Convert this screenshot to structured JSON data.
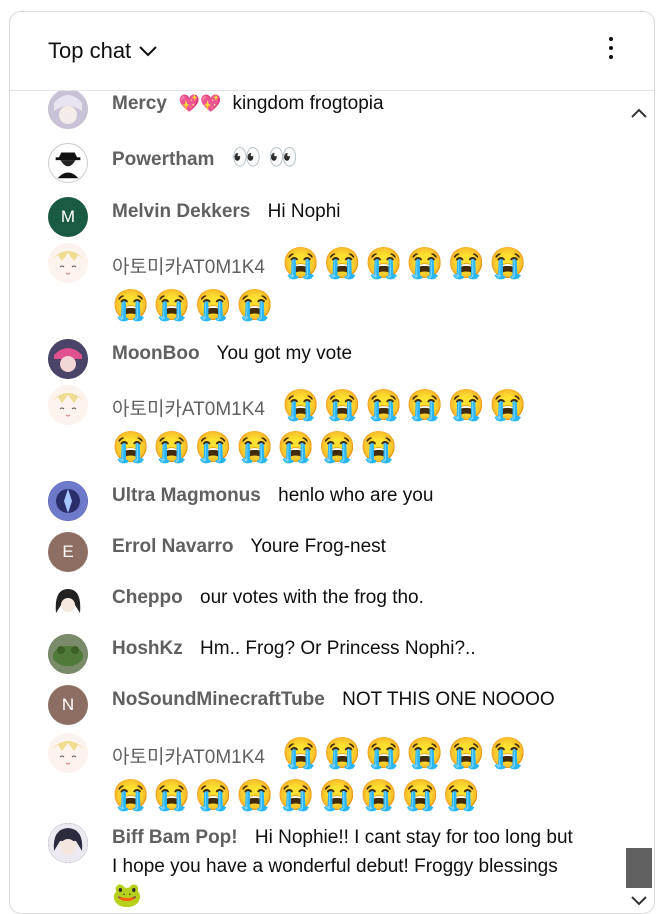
{
  "header": {
    "title": "Top chat"
  },
  "messages": [
    {
      "author": "Mercy",
      "badge": "💖💖",
      "text": "kingdom frogtopia"
    },
    {
      "author": "Powertham",
      "text": "👀 👀"
    },
    {
      "author": "Melvin Dekkers",
      "initial": "M",
      "text": "Hi Nophi"
    },
    {
      "author": "아토미카AT0M1K4",
      "line1": "😭😭😭😭😭😭",
      "line2": "😭😭😭😭"
    },
    {
      "author": "MoonBoo",
      "text": "You got my vote"
    },
    {
      "author": "아토미카AT0M1K4",
      "line1": "😭😭😭😭😭😭",
      "line2": "😭😭😭😭😭😭😭"
    },
    {
      "author": "Ultra Magmonus",
      "text": "henlo who are you"
    },
    {
      "author": "Errol Navarro",
      "initial": "E",
      "text": "Youre Frog-nest"
    },
    {
      "author": "Cheppo",
      "text": "our votes with the frog tho."
    },
    {
      "author": "HoshKz",
      "text": "Hm.. Frog? Or Princess Nophi?.."
    },
    {
      "author": "NoSoundMinecraftTube",
      "initial": "N",
      "text": "NOT THIS ONE NOOOO"
    },
    {
      "author": "아토미카AT0M1K4",
      "line1": "😭😭😭😭😭😭",
      "line2": "😭😭😭😭😭😭😭😭😭"
    },
    {
      "author": "Biff Bam Pop!",
      "text": "Hi Nophie!! I cant stay for too long but I hope you have a wonderful debut! Froggy blessings",
      "emoji": "🐸"
    }
  ],
  "colors": {
    "avatar_melvin": "#1c5b43",
    "avatar_errol": "#8d6e63",
    "avatar_nosound": "#8d6e63"
  }
}
